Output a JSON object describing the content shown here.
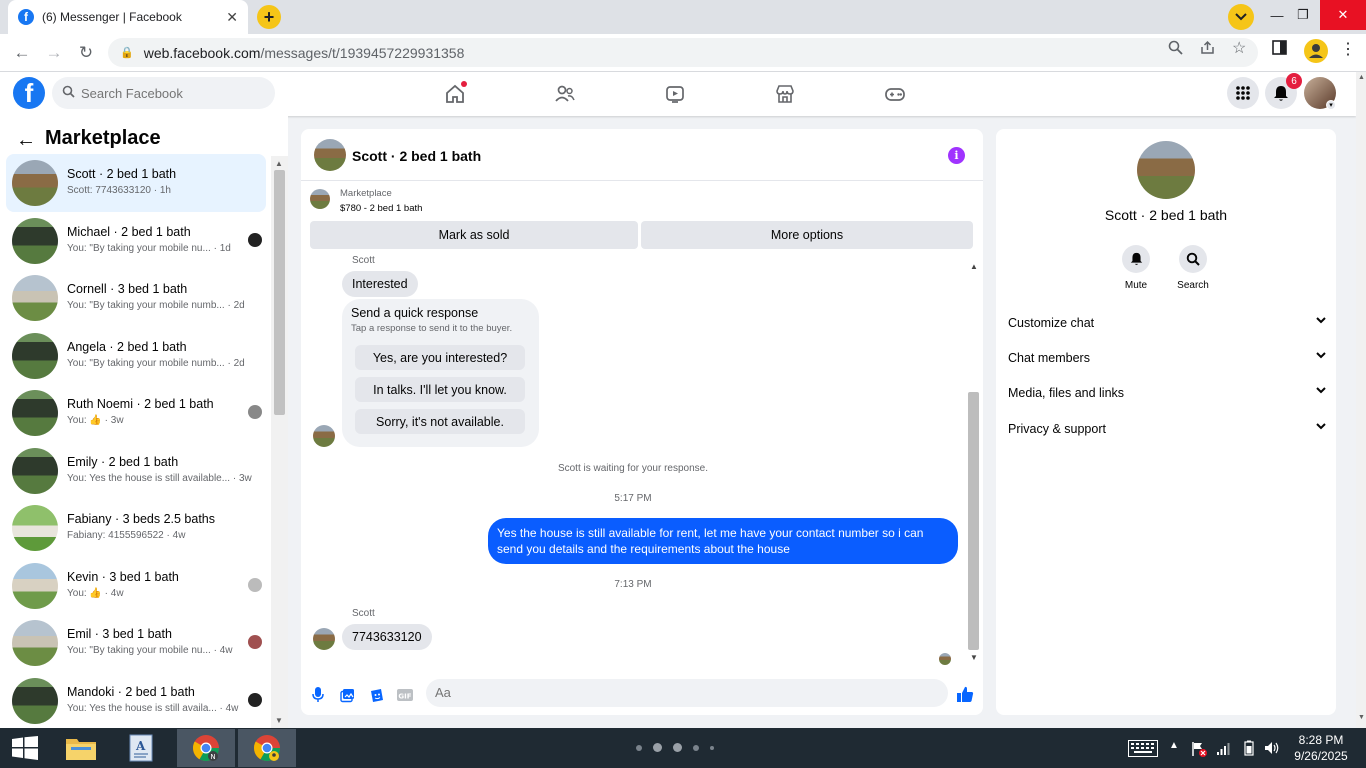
{
  "browser": {
    "tab_title": "(6) Messenger | Facebook",
    "url_host": "web.facebook.com",
    "url_path": "/messages/t/1939457229931358"
  },
  "fb": {
    "search_placeholder": "Search Facebook",
    "notification_count": "6"
  },
  "left": {
    "title": "Marketplace",
    "conversations": [
      {
        "name": "Scott · 2 bed 1 bath",
        "snippet": "Scott: 7743633120 · 1h",
        "photo": "wood"
      },
      {
        "name": "Michael · 2 bed 1 bath",
        "snippet": "You: \"By taking your mobile nu... · 1d",
        "photo": "green"
      },
      {
        "name": "Cornell · 3 bed 1 bath",
        "snippet": "You: \"By taking your mobile numb... · 2d",
        "photo": "gray"
      },
      {
        "name": "Angela · 2 bed 1 bath",
        "snippet": "You: \"By taking your mobile numb... · 2d",
        "photo": "green"
      },
      {
        "name": "Ruth Noemi · 2 bed 1 bath",
        "snippet": "You: 👍 · 3w",
        "photo": "green"
      },
      {
        "name": "Emily · 2 bed 1 bath",
        "snippet": "You: Yes the house is still available... · 3w",
        "photo": "green"
      },
      {
        "name": "Fabiany · 3 beds 2.5 baths",
        "snippet": "Fabiany: 4155596522 · 4w",
        "photo": "tree"
      },
      {
        "name": "Kevin · 3 bed 1 bath",
        "snippet": "You: 👍 · 4w",
        "photo": "blue"
      },
      {
        "name": "Emil · 3 bed 1 bath",
        "snippet": "You: \"By taking your mobile nu... · 4w",
        "photo": "gray"
      },
      {
        "name": "Mandoki · 2 bed 1 bath",
        "snippet": "You: Yes the house is still availa... · 4w",
        "photo": "green"
      }
    ]
  },
  "chat": {
    "title": "Scott · 2 bed 1 bath",
    "listing_label": "Marketplace",
    "listing_price": "$780 - 2 bed 1 bath",
    "btn_mark_sold": "Mark as sold",
    "btn_more": "More options",
    "sender_top": "Scott",
    "msg_interested": "Interested",
    "qr_title": "Send a quick response",
    "qr_sub": "Tap a response to send it to the buyer.",
    "qr_options": [
      "Yes, are you interested?",
      "In talks. I'll let you know.",
      "Sorry, it's not available."
    ],
    "waiting_note": "Scott is waiting for your response.",
    "time1": "5:17 PM",
    "my_message": "Yes the house is still available for rent, let me have your contact number so i can send you details and the requirements about the house",
    "time2": "7:13 PM",
    "sender_bottom": "Scott",
    "msg_number": "7743633120",
    "composer_placeholder": "Aa"
  },
  "right": {
    "name": "Scott · 2 bed 1 bath",
    "mute_label": "Mute",
    "search_label": "Search",
    "sections": [
      "Customize chat",
      "Chat members",
      "Media, files and links",
      "Privacy & support"
    ]
  },
  "taskbar": {
    "time": "8:28 PM",
    "date": "9/26/2025"
  }
}
